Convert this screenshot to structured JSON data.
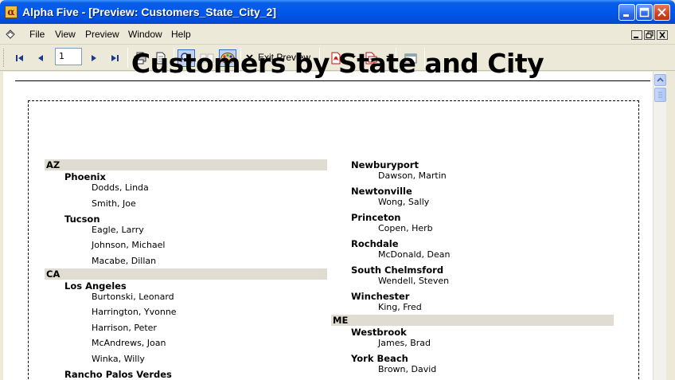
{
  "window": {
    "app_icon_glyph": "α",
    "title": "Alpha Five - [Preview: Customers_State_City_2]"
  },
  "menu": {
    "items": [
      "File",
      "View",
      "Preview",
      "Window",
      "Help"
    ]
  },
  "toolbar": {
    "page_number": "1",
    "exit_preview_label": "Exit Preview"
  },
  "report": {
    "title": "Customers by State and City",
    "left_column": [
      {
        "type": "state",
        "text": "AZ"
      },
      {
        "type": "city",
        "text": "Phoenix"
      },
      {
        "type": "customer",
        "text": "Dodds, Linda"
      },
      {
        "type": "customer",
        "text": "Smith, Joe"
      },
      {
        "type": "city",
        "text": "Tucson"
      },
      {
        "type": "customer",
        "text": "Eagle, Larry"
      },
      {
        "type": "customer",
        "text": "Johnson, Michael"
      },
      {
        "type": "customer",
        "text": "Macabe, Dillan"
      },
      {
        "type": "state",
        "text": "CA"
      },
      {
        "type": "city",
        "text": "Los Angeles"
      },
      {
        "type": "customer",
        "text": "Burtonski, Leonard"
      },
      {
        "type": "customer",
        "text": "Harrington, Yvonne"
      },
      {
        "type": "customer",
        "text": "Harrison, Peter"
      },
      {
        "type": "customer",
        "text": "McAndrews, Joan"
      },
      {
        "type": "customer",
        "text": "Winka, Willy"
      },
      {
        "type": "city",
        "text": "Rancho Palos Verdes"
      }
    ],
    "right_column": [
      {
        "type": "city",
        "text": "Newburyport"
      },
      {
        "type": "customer",
        "text": "Dawson, Martin"
      },
      {
        "type": "city",
        "text": "Newtonville"
      },
      {
        "type": "customer",
        "text": "Wong, Sally"
      },
      {
        "type": "city",
        "text": "Princeton"
      },
      {
        "type": "customer",
        "text": "Copen, Herb"
      },
      {
        "type": "city",
        "text": "Rochdale"
      },
      {
        "type": "customer",
        "text": "McDonald, Dean"
      },
      {
        "type": "city",
        "text": "South Chelmsford"
      },
      {
        "type": "customer",
        "text": "Wendell, Steven"
      },
      {
        "type": "city",
        "text": "Winchester"
      },
      {
        "type": "customer",
        "text": "King, Fred"
      },
      {
        "type": "state",
        "text": "ME"
      },
      {
        "type": "city",
        "text": "Westbrook"
      },
      {
        "type": "customer",
        "text": "James, Brad"
      },
      {
        "type": "city",
        "text": "York Beach"
      },
      {
        "type": "customer",
        "text": "Brown, David"
      }
    ]
  },
  "colors": {
    "titlebar": "#0054e3",
    "state_band": "#e1dcd1",
    "chrome": "#ece9d8"
  }
}
